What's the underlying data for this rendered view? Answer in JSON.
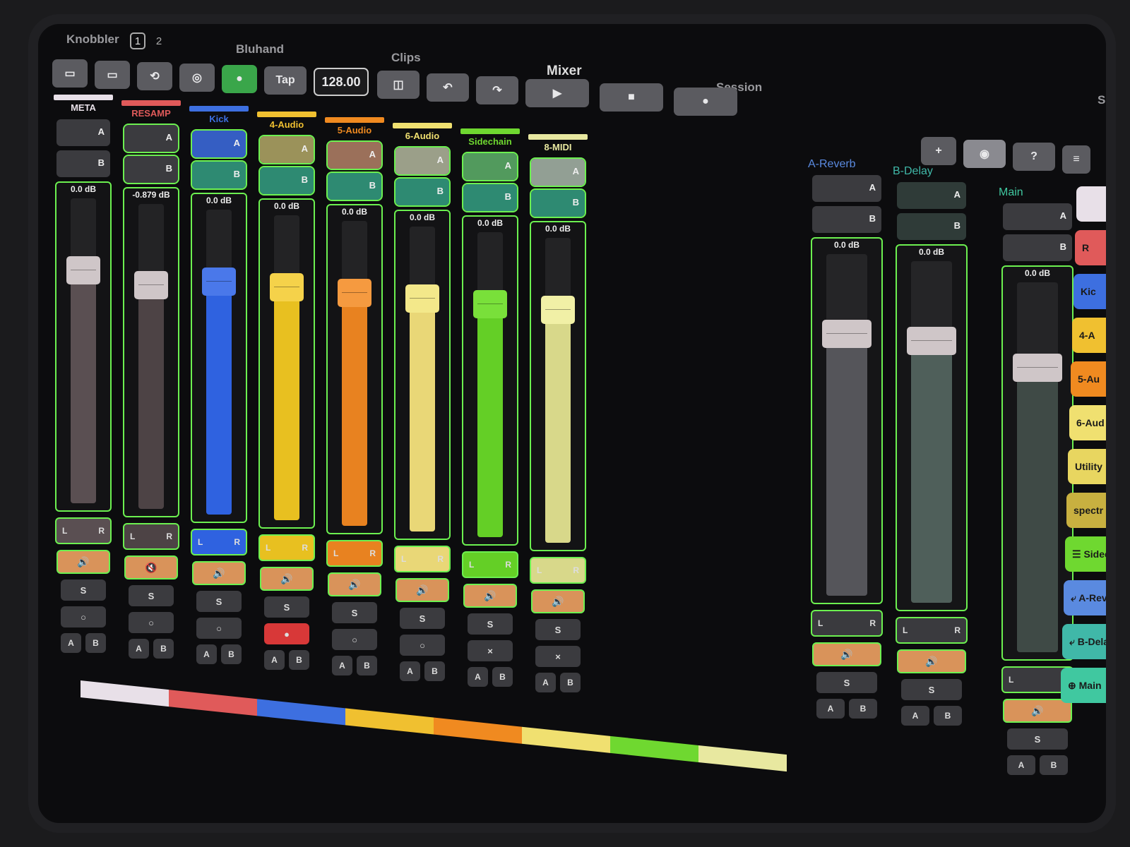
{
  "header": {
    "brand": "Knobbler",
    "pages": [
      "1",
      "2"
    ],
    "device_label": "Bluhand",
    "tabs": [
      "Clips",
      "Mixer",
      "Session",
      "Setu"
    ],
    "tempo": "128.00",
    "tap_label": "Tap",
    "plus_label": "+"
  },
  "channels": [
    {
      "name": "META",
      "color": "#e8e0e8",
      "db": "0.0 dB",
      "level": 0.8,
      "fill": "#5a4f52",
      "thumb": "#cfc6c8",
      "mute": "🔊",
      "solo": "S",
      "arm": "○"
    },
    {
      "name": "RESAMP",
      "color": "#e05a5a",
      "db": "-0.879 dB",
      "level": 0.77,
      "fill": "#4d4345",
      "thumb": "#cfc6c8",
      "mute": "🔇",
      "solo": "S",
      "arm": "○"
    },
    {
      "name": "Kick",
      "color": "#3d6fe0",
      "db": "0.0 dB",
      "level": 0.8,
      "fill": "#2f62e0",
      "thumb": "#4a78ea",
      "mute": "🔊",
      "solo": "S",
      "arm": "○"
    },
    {
      "name": "4-Audio",
      "color": "#f0c030",
      "db": "0.0 dB",
      "level": 0.8,
      "fill": "#e8c020",
      "thumb": "#f5d24a",
      "mute": "🔊",
      "solo": "S",
      "arm": "●"
    },
    {
      "name": "5-Audio",
      "color": "#f08a20",
      "db": "0.0 dB",
      "level": 0.8,
      "fill": "#e88220",
      "thumb": "#f59a40",
      "mute": "🔊",
      "solo": "S",
      "arm": "○"
    },
    {
      "name": "6-Audio",
      "color": "#f0e070",
      "db": "0.0 dB",
      "level": 0.8,
      "fill": "#e9d777",
      "thumb": "#f3e88a",
      "mute": "🔊",
      "solo": "S",
      "arm": "○"
    },
    {
      "name": "Sidechain",
      "color": "#6fd830",
      "db": "0.0 dB",
      "level": 0.8,
      "fill": "#64cf26",
      "thumb": "#79e03a",
      "mute": "🔊",
      "solo": "S",
      "arm": "×"
    },
    {
      "name": "8-MIDI",
      "color": "#e8e8a0",
      "db": "0.0 dB",
      "level": 0.8,
      "fill": "#d8d88a",
      "thumb": "#f1f0a6",
      "mute": "🔊",
      "solo": "S",
      "arm": "×"
    }
  ],
  "returns": [
    {
      "name": "A-Reverb",
      "color": "#5a8ae0",
      "db": "0.0 dB",
      "level": 0.8
    },
    {
      "name": "B-Delay",
      "color": "#40b8a8",
      "db": "0.0 dB",
      "level": 0.8
    }
  ],
  "master": {
    "name": "Main",
    "db": "0.0 dB",
    "level": 0.8
  },
  "send_labels": {
    "a": "A",
    "b": "B"
  },
  "pan_labels": {
    "l": "L",
    "r": "R"
  },
  "ab_labels": {
    "a": "A",
    "b": "B"
  },
  "track_list": [
    {
      "label": "",
      "color": "#e8e0e8"
    },
    {
      "label": "R",
      "color": "#e05a5a"
    },
    {
      "label": "Kic",
      "color": "#3d6fe0"
    },
    {
      "label": "4-A",
      "color": "#f0c030"
    },
    {
      "label": "5-Au",
      "color": "#f08a20"
    },
    {
      "label": "6-Aud",
      "color": "#f0e070"
    },
    {
      "label": "Utility",
      "color": "#e8d660"
    },
    {
      "label": "spectr",
      "color": "#c8b040"
    },
    {
      "label": "☰ Sidecha",
      "color": "#6fd830"
    },
    {
      "label": "⤶ A-Reverb",
      "color": "#5a8ae0"
    },
    {
      "label": "⤶ B-Delay",
      "color": "#40b8a8"
    },
    {
      "label": "⊕ Main",
      "color": "#40c8a0"
    }
  ],
  "palette": [
    "#e8e0e8",
    "#e05a5a",
    "#3d6fe0",
    "#f0c030",
    "#f08a20",
    "#f0e070",
    "#6fd830",
    "#e8e8a0"
  ]
}
